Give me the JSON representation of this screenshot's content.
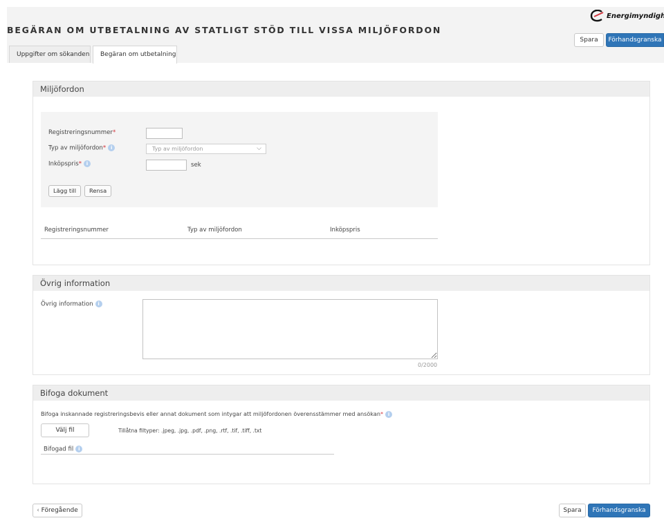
{
  "header": {
    "title": "BEGÄRAN OM UTBETALNING AV STATLIGT STÖD TILL VISSA MILJÖFORDON",
    "logo_text": "Energimyndighete",
    "save_label": "Spara",
    "preview_label": "Förhandsgranska"
  },
  "tabs": [
    {
      "label": "Uppgifter om sökanden",
      "active": false
    },
    {
      "label": "Begäran om utbetalning",
      "active": true
    }
  ],
  "vehicles": {
    "heading": "Miljöfordon",
    "reg_label": "Registreringsnummer",
    "type_label": "Typ av miljöfordon",
    "price_label": "Inköpspris",
    "required_mark": "*",
    "reg_value": "",
    "type_placeholder": "Typ av miljöfordon",
    "price_value": "",
    "price_unit": "sek",
    "add_label": "Lägg till",
    "clear_label": "Rensa",
    "table_columns": [
      "Registreringsnummer",
      "Typ av miljöfordon",
      "Inköpspris"
    ],
    "table_rows": []
  },
  "other": {
    "heading": "Övrig information",
    "label": "Övrig information",
    "value": "",
    "counter": "0/2000"
  },
  "attachments": {
    "heading": "Bifoga dokument",
    "instruction": "Bifoga inskannade registreringsbevis eller annat dokument som intygar att miljöfordonen överensstämmer med ansökan",
    "required_mark": "*",
    "choose_file_label": "Välj fil",
    "allowed_types": "Tillåtna filtyper: .jpeg, .jpg, .pdf, .png, .rtf, .tif, .tiff, .txt",
    "attached_label": "Bifogad fil"
  },
  "footer": {
    "previous_label": "Föregående",
    "previous_icon": "chevron-left-icon",
    "save_label": "Spara",
    "preview_label": "Förhandsgranska"
  },
  "colors": {
    "primary": "#2f75b7",
    "required": "#d2343c",
    "info_icon": "#b4cfee",
    "panel_header": "#eeeeee"
  }
}
